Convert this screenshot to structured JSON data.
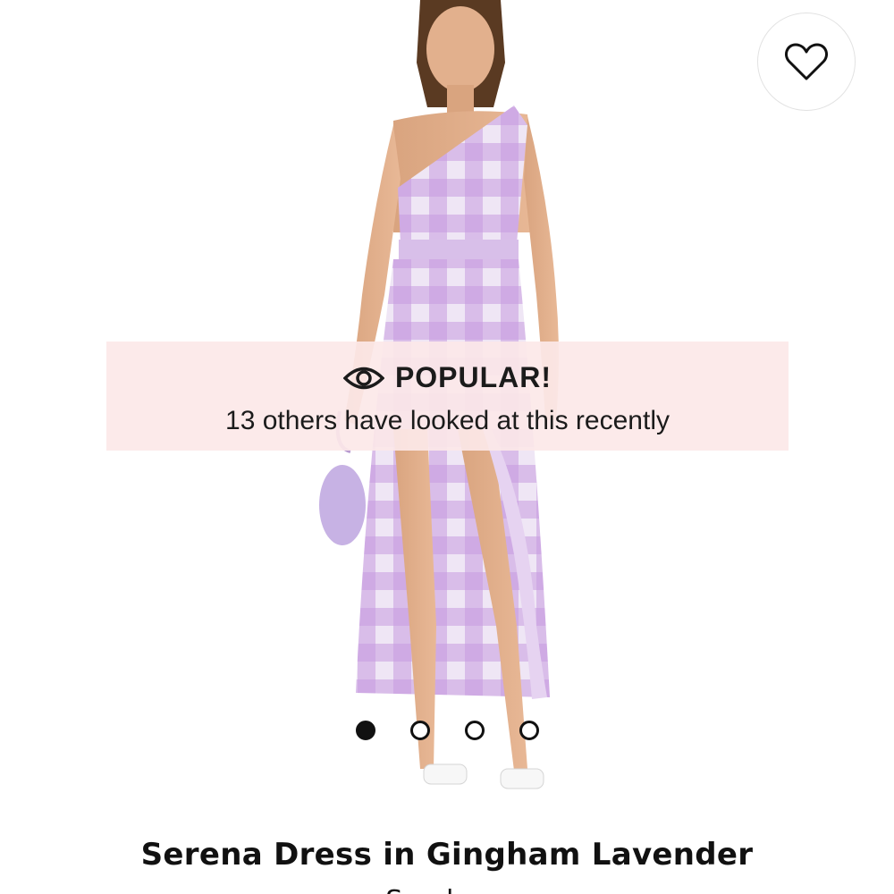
{
  "favorite": {
    "icon": "heart-outline-icon"
  },
  "banner": {
    "icon": "eye-icon",
    "title": "POPULAR!",
    "subtext": "13 others have looked at this recently"
  },
  "carousel": {
    "total_images": 4,
    "active_index": 1
  },
  "product": {
    "title": "Serena Dress in Gingham Lavender",
    "brand": "Sundress"
  },
  "colors": {
    "banner_background": "#fce8e8",
    "dress_lavender": "#c79be0",
    "text": "#111111"
  }
}
